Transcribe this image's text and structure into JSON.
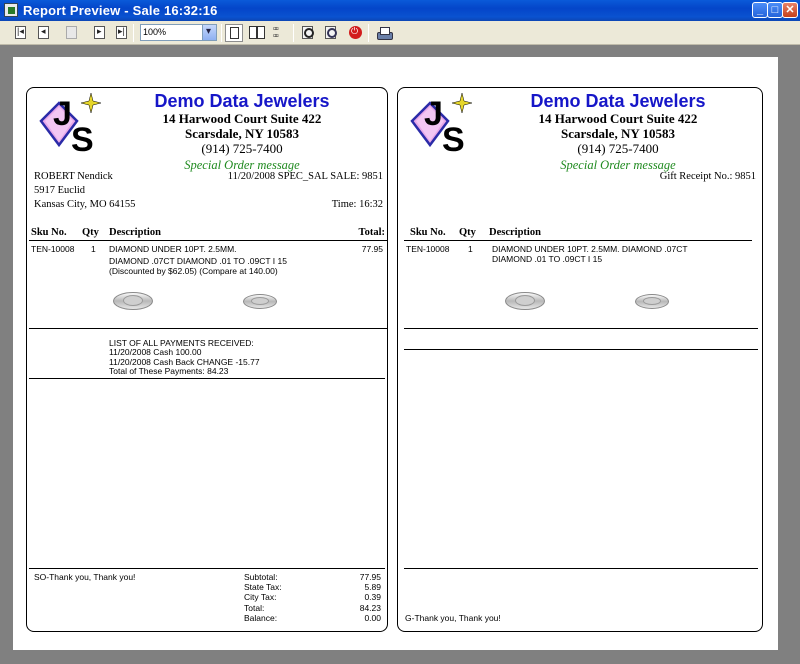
{
  "window": {
    "title": "Report Preview - Sale   16:32:16",
    "minimize": "_",
    "maximize": "□",
    "close": "✕"
  },
  "toolbar": {
    "zoom": "100%",
    "buttons": [
      "first-page",
      "prev-page",
      "copy",
      "next-page",
      "last-page",
      "single-page",
      "two-pages",
      "four-pages",
      "zoom-in",
      "zoom-out",
      "stop",
      "print"
    ]
  },
  "company": {
    "name": "Demo Data Jewelers",
    "address1": "14 Harwood Court Suite 422",
    "address2": "Scarsdale, NY 10583",
    "phone": "(914) 725-7400",
    "message": "Special Order message"
  },
  "colors": {
    "company_name": "#1616c8",
    "message": "#1f8a1f"
  },
  "sale_receipt": {
    "customer": {
      "name": "ROBERT Nendick",
      "street": "5917 Euclid",
      "city": "Kansas City, MO  64155"
    },
    "sale_line": "11/20/2008  SPEC_SAL SALE: 9851",
    "time": "Time: 16:32",
    "columns": [
      "Sku No.",
      "Qty",
      "Description",
      "Total:"
    ],
    "item": {
      "sku": "TEN-10008",
      "qty": "1",
      "desc1": "DIAMOND UNDER 10PT. 2.5MM.",
      "desc2": "DIAMOND .07CT DIAMOND .01 TO .09CT I 15",
      "desc3": "(Discounted by $62.05) (Compare at 140.00)",
      "total": "77.95"
    },
    "payments": [
      "LIST OF ALL PAYMENTS RECEIVED:",
      "11/20/2008 Cash  100.00",
      "11/20/2008 Cash Back CHANGE -15.77",
      "Total of These Payments: 84.23"
    ],
    "footer_note": "SO-Thank you, Thank you!",
    "totals": [
      {
        "label": "Subtotal:",
        "value": "77.95"
      },
      {
        "label": "State Tax:",
        "value": "5.89"
      },
      {
        "label": "City Tax:",
        "value": "0.39"
      },
      {
        "label": "Total:",
        "value": "84.23"
      },
      {
        "label": "Balance:",
        "value": "0.00"
      }
    ]
  },
  "gift_receipt": {
    "gift_no": "Gift Receipt No.: 9851",
    "columns": [
      "Sku No.",
      "Qty",
      "Description"
    ],
    "item": {
      "sku": "TEN-10008",
      "qty": "1",
      "desc1": "DIAMOND UNDER 10PT. 2.5MM. DIAMOND .07CT",
      "desc2": "DIAMOND .01 TO .09CT I 15"
    },
    "footer_note": "G-Thank you, Thank you!"
  }
}
